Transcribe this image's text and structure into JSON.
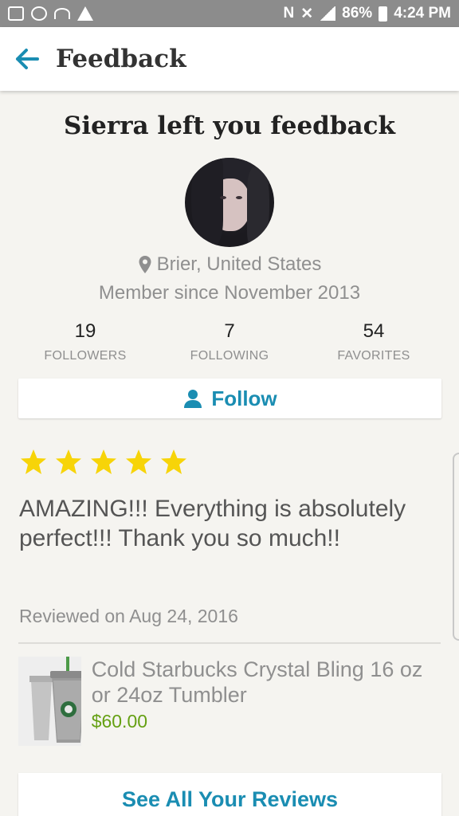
{
  "status_bar": {
    "battery": "86%",
    "time": "4:24 PM",
    "icons": [
      "image-icon",
      "sync-icon",
      "wifi-icon",
      "warning-icon",
      "nfc-icon",
      "mute-icon",
      "wifi-icon",
      "signal-icon",
      "battery-icon"
    ]
  },
  "app_bar": {
    "back_icon": "arrow-left-icon",
    "title": "Feedback"
  },
  "profile": {
    "heading": "Sierra left you feedback",
    "location": "Brier, United States",
    "member_since": "Member since November 2013",
    "stats": [
      {
        "value": "19",
        "label": "FOLLOWERS"
      },
      {
        "value": "7",
        "label": "FOLLOWING"
      },
      {
        "value": "54",
        "label": "FAVORITES"
      }
    ],
    "follow_label": "Follow"
  },
  "review": {
    "rating": 5,
    "max_rating": 5,
    "text": "AMAZING!!! Everything is absolutely perfect!!! Thank you so much!!",
    "date": "Reviewed on Aug 24, 2016"
  },
  "product": {
    "title": "Cold Starbucks Crystal Bling 16 oz or 24oz Tumbler",
    "price": "$60.00"
  },
  "footer": {
    "see_all_label": "See All Your Reviews"
  },
  "colors": {
    "accent": "#1a8db2",
    "price": "#65a013",
    "star": "#f7d408"
  }
}
